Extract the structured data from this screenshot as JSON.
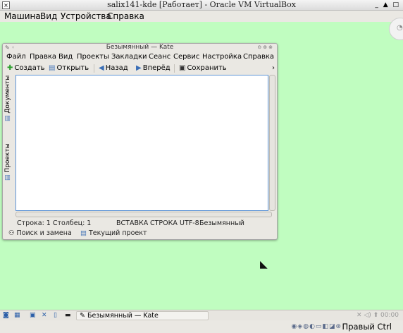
{
  "host": {
    "title": "salix141-kde [Работает] - Oracle VM VirtualBox",
    "menu": [
      "Машина",
      "Вид",
      "Устройства",
      "Справка"
    ],
    "window_buttons": "_ ▲ □",
    "host_key": "Правый Ctrl",
    "indicators": "◉◈◍◐▭◧◪⊛"
  },
  "kate": {
    "title": "Безымянный — Kate",
    "menu": [
      "Файл",
      "Правка",
      "Вид",
      "Проекты",
      "Закладки",
      "Сеанс",
      "Сервис",
      "Настройка",
      "Справка"
    ],
    "toolbar": {
      "new": "Создать",
      "open": "Открыть",
      "back": "Назад",
      "forward": "Вперёд",
      "save": "Сохранить",
      "more": "›"
    },
    "side_tabs": [
      "Документы",
      "Проекты"
    ],
    "status": {
      "cursor": "Строка: 1 Столбец: 1",
      "mode": "ВСТАВКА",
      "line_mode": "СТРОКА",
      "encoding": "UTF-8",
      "filename": "Безымянный"
    },
    "bottom_tabs": [
      "Поиск и замена",
      "Текущий проект"
    ]
  },
  "taskbar": {
    "task": "Безымянный — Kate",
    "tray_right": "✕ ◁) ⬆ 00:00"
  },
  "colors": {
    "desktop_bg": "#c0fdc0",
    "editor_border": "#5d94d6",
    "chrome": "#eae8e3"
  }
}
